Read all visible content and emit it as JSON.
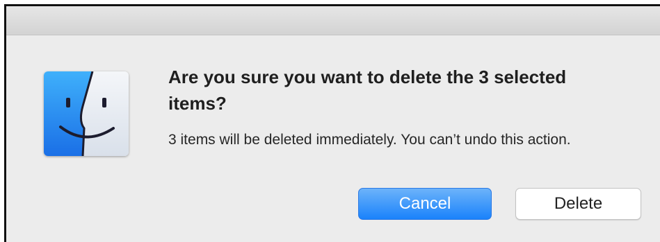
{
  "dialog": {
    "title": "Are you sure you want to delete the 3 selected items?",
    "message": "3 items will be deleted immediately. You can’t undo this action.",
    "buttons": {
      "cancel_label": "Cancel",
      "delete_label": "Delete"
    },
    "icon": "finder-icon"
  },
  "colors": {
    "default_button": "#1a82fb",
    "dialog_background": "#ececec",
    "finder_blue": "#1f86ef",
    "finder_light": "#e9eef5"
  }
}
